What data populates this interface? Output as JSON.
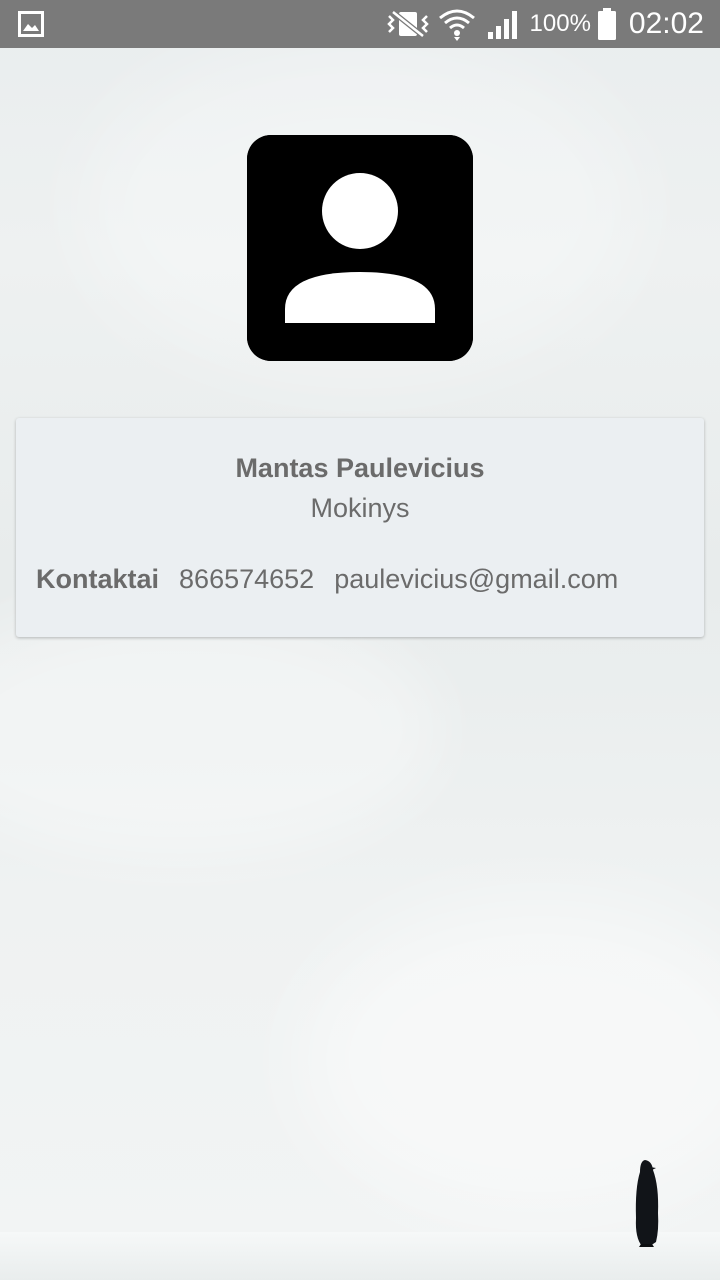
{
  "status_bar": {
    "battery_percent": "100%",
    "time": "02:02",
    "icons": [
      "gallery-notification-icon",
      "vibrate-icon",
      "wifi-icon",
      "signal-icon",
      "battery-icon"
    ]
  },
  "profile": {
    "avatar_icon": "account-box-icon",
    "name": "Mantas Paulevicius",
    "role": "Mokinys",
    "contacts_label": "Kontaktai",
    "phone": "866574652",
    "email": "paulevicius@gmail.com"
  },
  "colors": {
    "status_bar_bg": "#7a7a7a",
    "card_bg": "#ebeff2",
    "text": "#6b6b6b",
    "avatar_bg": "#000000"
  }
}
